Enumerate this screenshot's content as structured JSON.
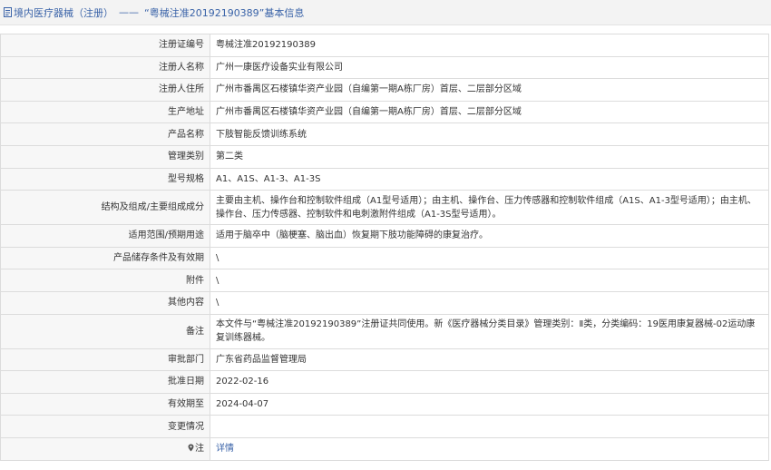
{
  "header": {
    "title_prefix": "境内医疗器械（注册）",
    "separator": "——",
    "title_main": "“粤械注准20192190389”基本信息"
  },
  "rows": [
    {
      "label": "注册证编号",
      "value": "粤械注准20192190389"
    },
    {
      "label": "注册人名称",
      "value": "广州一康医疗设备实业有限公司"
    },
    {
      "label": "注册人住所",
      "value": "广州市番禺区石楼镇华资产业园（自编第一期A栋厂房）首层、二层部分区域"
    },
    {
      "label": "生产地址",
      "value": "广州市番禺区石楼镇华资产业园（自编第一期A栋厂房）首层、二层部分区域"
    },
    {
      "label": "产品名称",
      "value": "下肢智能反馈训练系统"
    },
    {
      "label": "管理类别",
      "value": "第二类"
    },
    {
      "label": "型号规格",
      "value": "A1、A1S、A1-3、A1-3S"
    },
    {
      "label": "结构及组成/主要组成成分",
      "value": "主要由主机、操作台和控制软件组成（A1型号适用）；由主机、操作台、压力传感器和控制软件组成（A1S、A1-3型号适用）；由主机、操作台、压力传感器、控制软件和电刺激附件组成（A1-3S型号适用）。"
    },
    {
      "label": "适用范围/预期用途",
      "value": "适用于脑卒中（脑梗塞、脑出血）恢复期下肢功能障碍的康复治疗。"
    },
    {
      "label": "产品储存条件及有效期",
      "value": "\\"
    },
    {
      "label": "附件",
      "value": "\\"
    },
    {
      "label": "其他内容",
      "value": "\\"
    },
    {
      "label": "备注",
      "value": "本文件与“粤械注准20192190389”注册证共同使用。新《医疗器械分类目录》管理类别：Ⅱ类，分类编码：19医用康复器械-02运动康复训练器械。"
    },
    {
      "label": "审批部门",
      "value": "广东省药品监督管理局"
    },
    {
      "label": "批准日期",
      "value": "2022-02-16"
    },
    {
      "label": "有效期至",
      "value": "2024-04-07"
    },
    {
      "label": "变更情况",
      "value": ""
    },
    {
      "label": "注",
      "value": "详情"
    }
  ],
  "colors": {
    "link": "#3a63a8",
    "label_bg": "#f7f7f7",
    "border": "#dcdcdc"
  }
}
